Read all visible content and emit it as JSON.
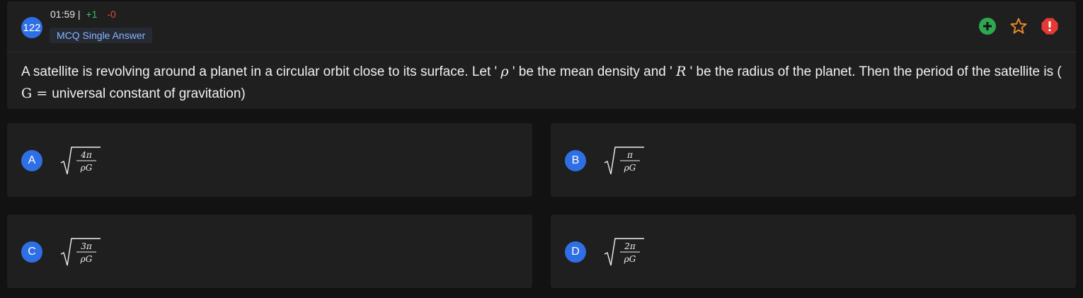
{
  "question": {
    "number": "122",
    "timer": "01:59 |",
    "positive_marks": "+1",
    "negative_marks": "-0",
    "type": "MCQ Single Answer",
    "text_part1": "A satellite is revolving around a planet in a circular orbit close to its surface. Let ' ",
    "rho": "ρ",
    "text_part2": " ' be the mean density and ' ",
    "R": "R",
    "text_part3": " ' be the radius of the planet. Then the period of the satellite is ( ",
    "G": "G",
    "eq": " = ",
    "text_part4": "universal constant of gravitation)"
  },
  "header_icons": {
    "add": "plus-circle-icon",
    "bookmark": "star-icon",
    "report": "alert-icon",
    "colors": {
      "add": "#2ea84f",
      "bookmark": "#e8862a",
      "report": "#e53935"
    }
  },
  "options": [
    {
      "letter": "A",
      "numerator": "4π",
      "denominator": "ρG"
    },
    {
      "letter": "B",
      "numerator": "π",
      "denominator": "ρG"
    },
    {
      "letter": "C",
      "numerator": "3π",
      "denominator": "ρG"
    },
    {
      "letter": "D",
      "numerator": "2π",
      "denominator": "ρG"
    }
  ],
  "accent_color": "#2f6fe6"
}
